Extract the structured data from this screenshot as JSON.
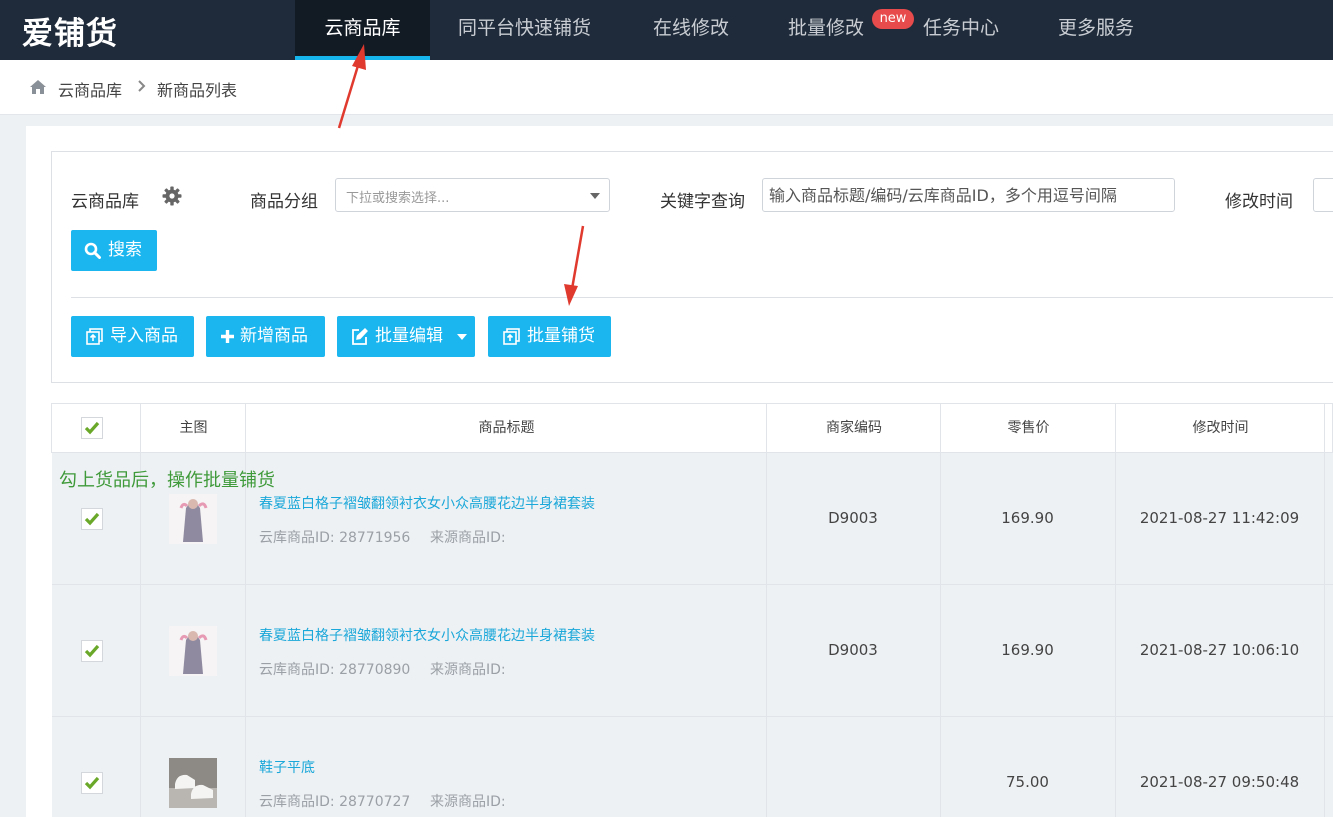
{
  "app": {
    "logo": "爱铺货"
  },
  "nav": {
    "items": [
      {
        "label": "云商品库",
        "active": true
      },
      {
        "label": "同平台快速铺货"
      },
      {
        "label": "在线修改"
      },
      {
        "label": "批量修改"
      },
      {
        "label": "任务中心"
      },
      {
        "label": "更多服务"
      }
    ],
    "new_badge": "new"
  },
  "breadcrumb": {
    "home_icon": "home-icon",
    "items": [
      "云商品库",
      "新商品列表"
    ]
  },
  "filters": {
    "library_label": "云商品库",
    "group_label": "商品分组",
    "group_placeholder": "下拉或搜索选择...",
    "keyword_label": "关键字查询",
    "keyword_placeholder": "输入商品标题/编码/云库商品ID，多个用逗号间隔",
    "time_label": "修改时间",
    "search_button": "搜索"
  },
  "actions": {
    "import": "导入商品",
    "add": "新增商品",
    "batch_edit": "批量编辑",
    "batch_publish": "批量铺货"
  },
  "table": {
    "headers": [
      "主图",
      "商品标题",
      "商家编码",
      "零售价",
      "修改时间"
    ],
    "rows": [
      {
        "title": "春夏蓝白格子褶皱翻领衬衣女小众高腰花边半身裙套装",
        "cloud_id": "云库商品ID: 28771956",
        "source_id": "来源商品ID:",
        "code": "D9003",
        "price": "169.90",
        "modified": "2021-08-27 11:42:09",
        "checked": true
      },
      {
        "title": "春夏蓝白格子褶皱翻领衬衣女小众高腰花边半身裙套装",
        "cloud_id": "云库商品ID: 28770890",
        "source_id": "来源商品ID:",
        "code": "D9003",
        "price": "169.90",
        "modified": "2021-08-27 10:06:10",
        "checked": true
      },
      {
        "title": "鞋子平底",
        "cloud_id": "云库商品ID: 28770727",
        "source_id": "来源商品ID:",
        "code": "",
        "price": "75.00",
        "modified": "2021-08-27 09:50:48",
        "checked": true
      }
    ]
  },
  "annotation": "勾上货品后，操作批量铺货",
  "colors": {
    "nav_bg": "#1f2b3a",
    "accent": "#1bb6ef",
    "badge": "#e84b4b",
    "annotation": "#3f9a3a",
    "arrow": "#e03a2f"
  }
}
